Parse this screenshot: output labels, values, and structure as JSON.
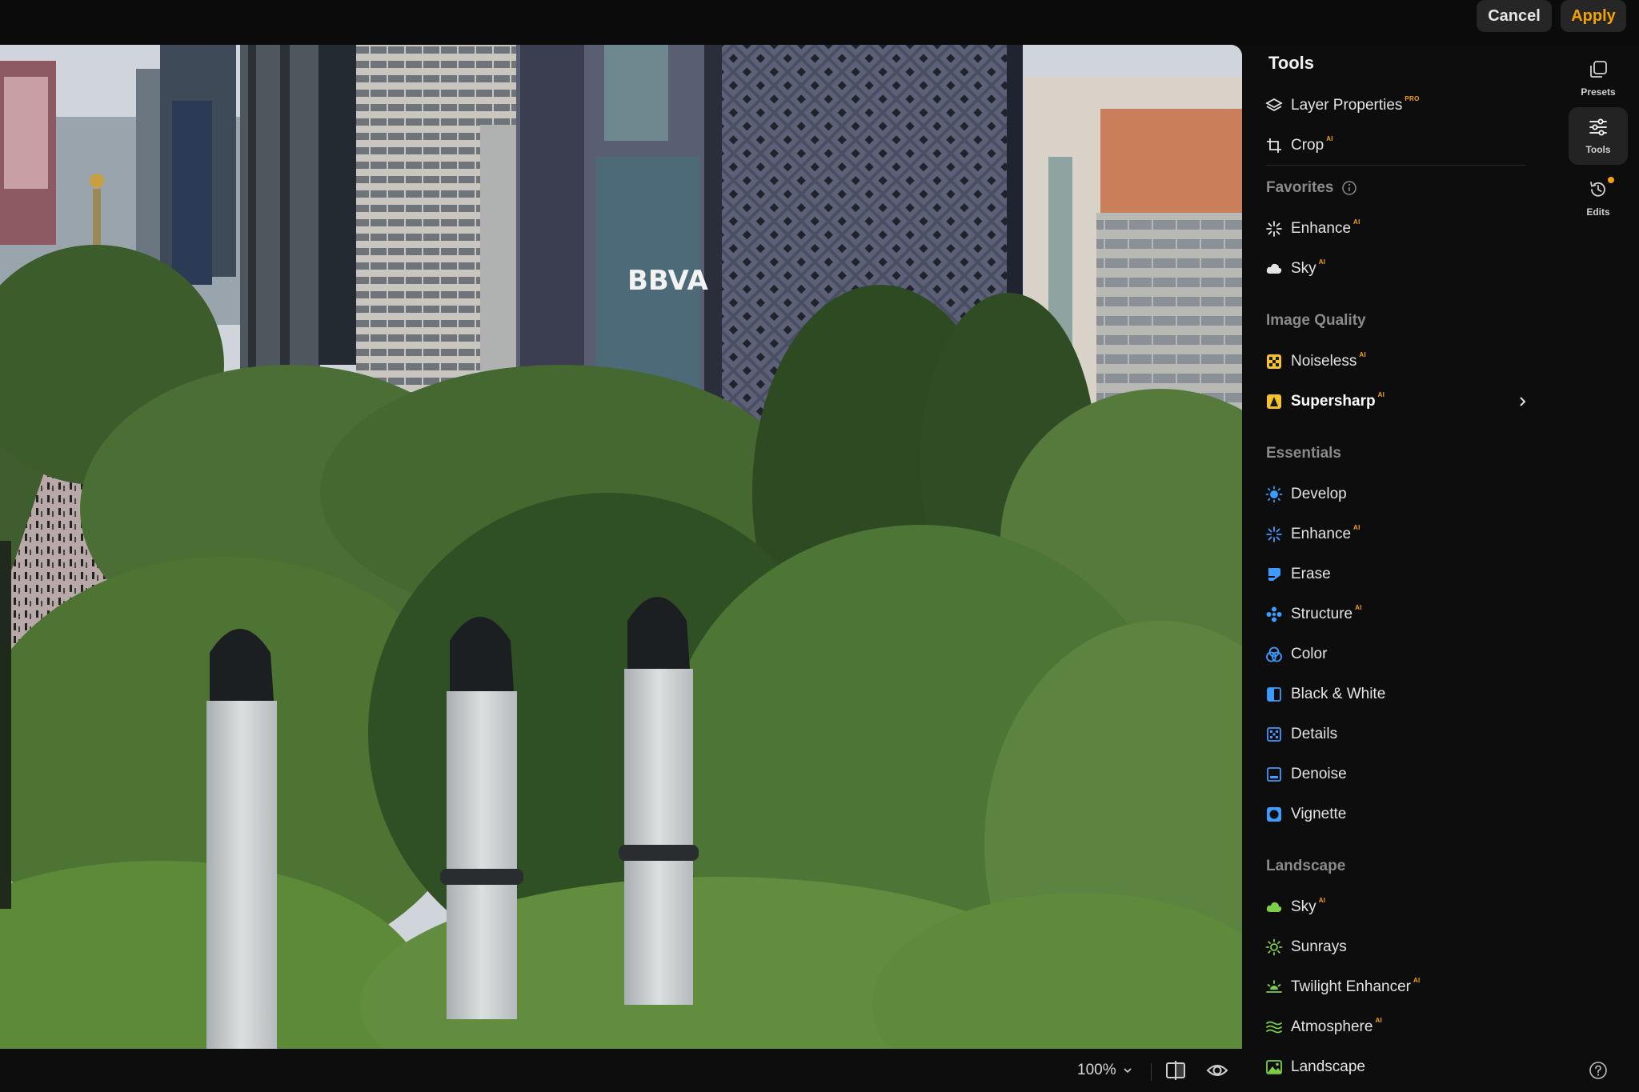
{
  "topbar": {
    "cancel_label": "Cancel",
    "apply_label": "Apply"
  },
  "canvas": {
    "sign_text": "BBVA"
  },
  "bottombar": {
    "zoom_label": "100%"
  },
  "panel": {
    "title": "Tools",
    "top_items": [
      {
        "label": "Layer Properties",
        "badge": "PRO",
        "icon": "layers-icon"
      },
      {
        "label": "Crop",
        "badge": "AI",
        "icon": "crop-icon"
      }
    ],
    "sections": [
      {
        "header": "Favorites",
        "info_icon": "info-icon",
        "items": [
          {
            "label": "Enhance",
            "badge": "AI",
            "icon": "sparkle-icon"
          },
          {
            "label": "Sky",
            "badge": "AI",
            "icon": "cloud-icon"
          }
        ]
      },
      {
        "header": "Image Quality",
        "items": [
          {
            "label": "Noiseless",
            "badge": "AI",
            "icon": "noiseless-icon"
          },
          {
            "label": "Supersharp",
            "badge": "AI",
            "icon": "supersharp-icon",
            "selected": true
          }
        ]
      },
      {
        "header": "Essentials",
        "items": [
          {
            "label": "Develop",
            "icon": "sun-icon"
          },
          {
            "label": "Enhance",
            "badge": "AI",
            "icon": "sparkle-icon"
          },
          {
            "label": "Erase",
            "icon": "eraser-icon"
          },
          {
            "label": "Structure",
            "badge": "AI",
            "icon": "structure-icon"
          },
          {
            "label": "Color",
            "icon": "color-icon"
          },
          {
            "label": "Black & White",
            "icon": "black-white-icon"
          },
          {
            "label": "Details",
            "icon": "details-icon"
          },
          {
            "label": "Denoise",
            "icon": "denoise-icon"
          },
          {
            "label": "Vignette",
            "icon": "vignette-icon"
          }
        ]
      },
      {
        "header": "Landscape",
        "items": [
          {
            "label": "Sky",
            "badge": "AI",
            "icon": "cloud-icon"
          },
          {
            "label": "Sunrays",
            "icon": "sunrays-icon"
          },
          {
            "label": "Twilight Enhancer",
            "badge": "AI",
            "icon": "twilight-icon"
          },
          {
            "label": "Atmosphere",
            "badge": "AI",
            "icon": "atmosphere-icon"
          },
          {
            "label": "Landscape",
            "icon": "landscape-icon"
          }
        ]
      }
    ]
  },
  "rail": {
    "presets_label": "Presets",
    "tools_label": "Tools",
    "edits_label": "Edits"
  },
  "colors": {
    "accent": "#f5a300",
    "blue": "#3d9bff",
    "yellow": "#f6c02a",
    "green": "#7ad148"
  }
}
